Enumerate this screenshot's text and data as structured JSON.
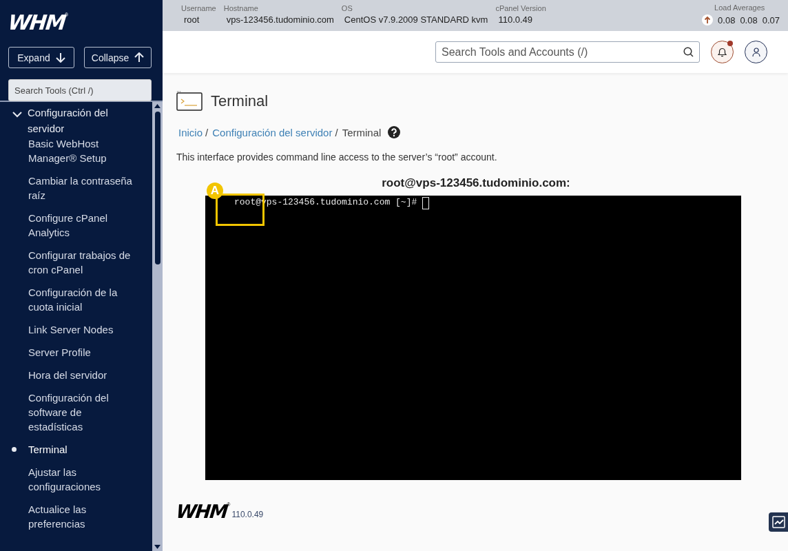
{
  "sidebar": {
    "logo": "WHM",
    "logo_mark": "®",
    "expand_button": "Expand",
    "collapse_button": "Collapse",
    "search": {
      "placeholder": "Search Tools (Ctrl /)"
    },
    "group": {
      "label": "Configuración del servidor",
      "expanded": true,
      "children": [
        {
          "label": "Basic WebHost Manager® Setup",
          "selected": false
        },
        {
          "label": "Cambiar la contraseña raíz",
          "selected": false
        },
        {
          "label": "Configure cPanel Analytics",
          "selected": false
        },
        {
          "label": "Configurar trabajos de cron cPanel",
          "selected": false
        },
        {
          "label": "Configuración de la cuota inicial",
          "selected": false
        },
        {
          "label": "Link Server Nodes",
          "selected": false
        },
        {
          "label": "Server Profile",
          "selected": false
        },
        {
          "label": "Hora del servidor",
          "selected": false
        },
        {
          "label": "Configuración del software de estadísticas",
          "selected": false
        },
        {
          "label": "Terminal",
          "selected": true
        },
        {
          "label": "Ajustar las configuraciones",
          "selected": false
        },
        {
          "label": "Actualice las preferencias",
          "selected": false
        }
      ]
    }
  },
  "info_bar": {
    "fields": [
      {
        "label": "Username",
        "value": "root"
      },
      {
        "label": "Hostname",
        "value": "vps-123456.tudominio.com"
      },
      {
        "label": "OS",
        "value": "CentOS v7.9.2009 STANDARD kvm"
      },
      {
        "label": "cPanel Version",
        "value": "110.0.49"
      }
    ],
    "load_averages": {
      "label": "Load Averages",
      "values": [
        "0.08",
        "0.08",
        "0.07"
      ]
    }
  },
  "top_bar": {
    "search": {
      "placeholder": "Search Tools and Accounts (/)"
    },
    "notifications": {
      "unread": true
    }
  },
  "page": {
    "title": "Terminal",
    "breadcrumbs": [
      {
        "label": "Inicio",
        "link": true
      },
      {
        "label": "Configuración del servidor",
        "link": true
      },
      {
        "label": "Terminal",
        "link": false
      }
    ],
    "separator": "/",
    "description": "This interface provides command line access to the server’s “root” account.",
    "terminal": {
      "heading": "root@vps-123456.tudominio.com:",
      "prompt": "root@vps-123456.tudominio.com [~]# "
    },
    "annotation": {
      "label": "A"
    }
  },
  "footer": {
    "logo": "WHM",
    "logo_mark": "®",
    "version": "110.0.49"
  }
}
